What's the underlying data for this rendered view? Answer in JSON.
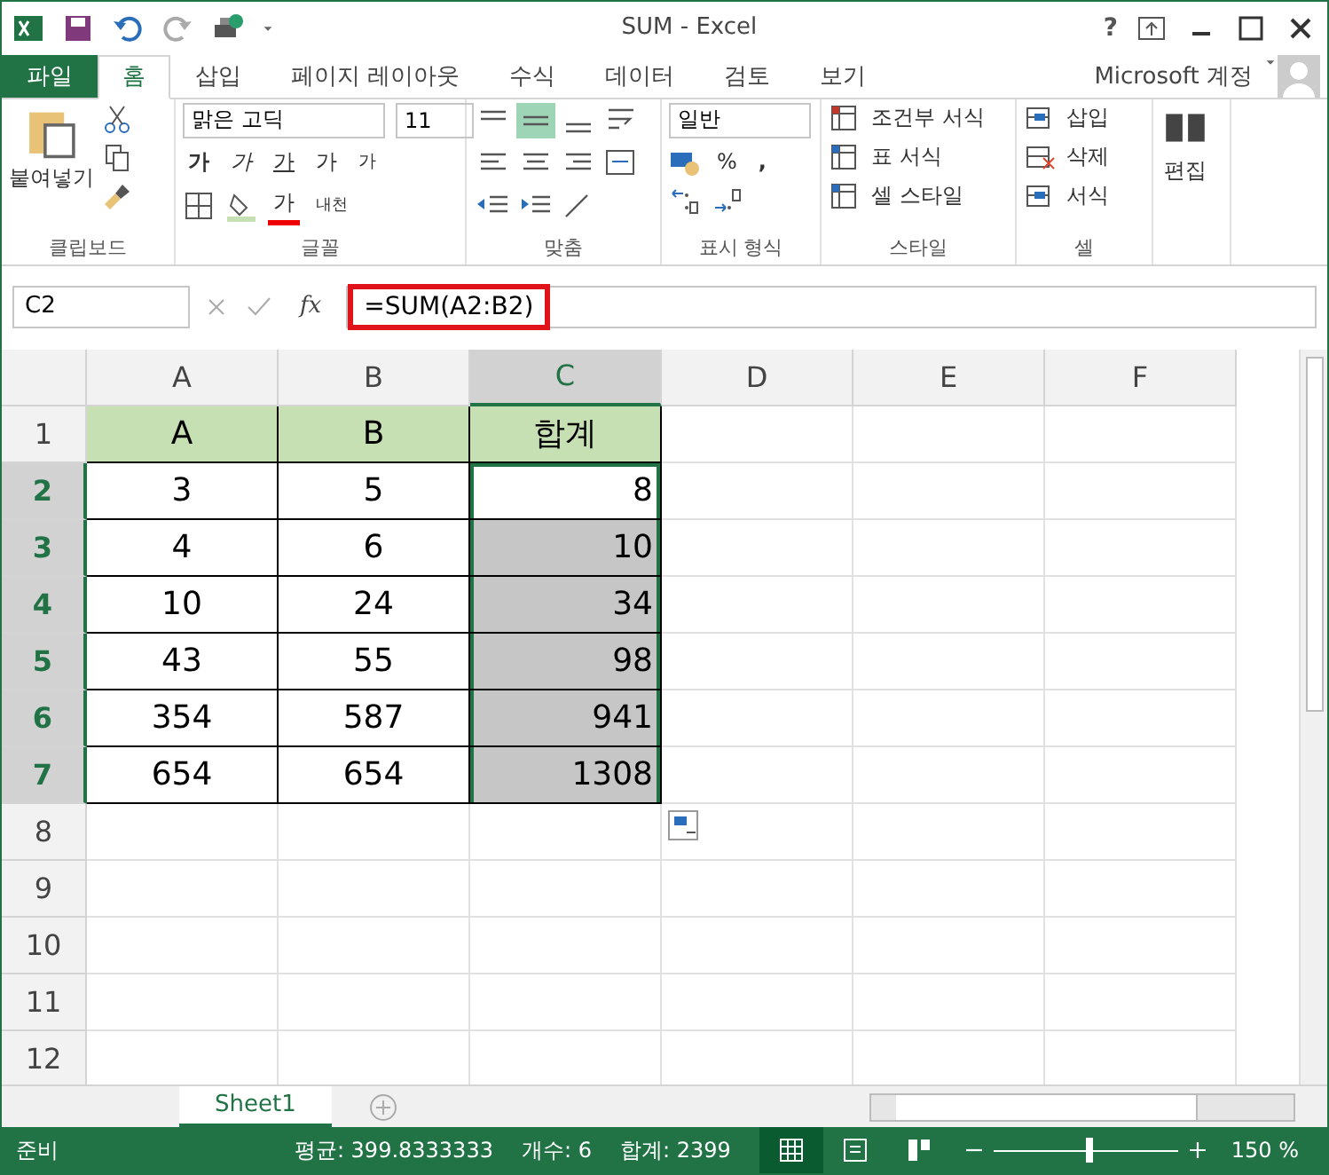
{
  "window": {
    "title": "SUM - Excel",
    "controls": [
      "?"
    ]
  },
  "tabs": [
    {
      "label": "파일",
      "kind": "file",
      "selected": false
    },
    {
      "label": "홈",
      "kind": "tab",
      "selected": true
    },
    {
      "label": "삽입",
      "kind": "tab",
      "selected": false
    },
    {
      "label": "페이지 레이아웃",
      "kind": "tab",
      "selected": false
    },
    {
      "label": "수식",
      "kind": "tab",
      "selected": false
    },
    {
      "label": "데이터",
      "kind": "tab",
      "selected": false
    },
    {
      "label": "검토",
      "kind": "tab",
      "selected": false
    },
    {
      "label": "보기",
      "kind": "tab",
      "selected": false
    }
  ],
  "account": {
    "label": "Microsoft 계정"
  },
  "ribbon": {
    "clipboard": {
      "label": "클립보드",
      "paste": "붙여넣기"
    },
    "font": {
      "label": "글꼴",
      "font_name": "맑은 고딕",
      "font_size": "11",
      "bold": "가",
      "italic": "가",
      "underline": "가",
      "grow": "가",
      "shrink": "가",
      "font_color": "가",
      "phonetic": "내천"
    },
    "alignment": {
      "label": "맞춤",
      "middle_align_selected": true
    },
    "number": {
      "label": "표시 형식",
      "format": "일반",
      "percent": "%",
      "comma": ","
    },
    "styles": {
      "label": "스타일",
      "items": [
        "조건부 서식",
        "표 서식",
        "셀 스타일"
      ]
    },
    "cells": {
      "label": "셀",
      "items": [
        "삽입",
        "삭제",
        "서식"
      ]
    },
    "editing": {
      "label": "편집"
    }
  },
  "formula_bar": {
    "name_box": "C2",
    "fx": "fx",
    "formula": "=SUM(A2:B2)",
    "highlighted": true
  },
  "columns": [
    {
      "label": "A",
      "selected": false
    },
    {
      "label": "B",
      "selected": false
    },
    {
      "label": "C",
      "selected": true
    },
    {
      "label": "D",
      "selected": false
    },
    {
      "label": "E",
      "selected": false
    },
    {
      "label": "F",
      "selected": false
    }
  ],
  "rows": [
    {
      "header": "1",
      "selected": false,
      "kind": "header",
      "cells": [
        {
          "text": "A",
          "selected": false,
          "active": false
        },
        {
          "text": "B",
          "selected": false,
          "active": false
        },
        {
          "text": "합계",
          "selected": false,
          "active": false
        }
      ]
    },
    {
      "header": "2",
      "selected": true,
      "kind": "data",
      "cells": [
        {
          "text": "3",
          "selected": false,
          "active": false
        },
        {
          "text": "5",
          "selected": false,
          "active": false
        },
        {
          "text": "8",
          "selected": true,
          "active": true
        }
      ]
    },
    {
      "header": "3",
      "selected": true,
      "kind": "data",
      "cells": [
        {
          "text": "4",
          "selected": false,
          "active": false
        },
        {
          "text": "6",
          "selected": false,
          "active": false
        },
        {
          "text": "10",
          "selected": true,
          "active": false
        }
      ]
    },
    {
      "header": "4",
      "selected": true,
      "kind": "data",
      "cells": [
        {
          "text": "10",
          "selected": false,
          "active": false
        },
        {
          "text": "24",
          "selected": false,
          "active": false
        },
        {
          "text": "34",
          "selected": true,
          "active": false
        }
      ]
    },
    {
      "header": "5",
      "selected": true,
      "kind": "data",
      "cells": [
        {
          "text": "43",
          "selected": false,
          "active": false
        },
        {
          "text": "55",
          "selected": false,
          "active": false
        },
        {
          "text": "98",
          "selected": true,
          "active": false
        }
      ]
    },
    {
      "header": "6",
      "selected": true,
      "kind": "data",
      "cells": [
        {
          "text": "354",
          "selected": false,
          "active": false
        },
        {
          "text": "587",
          "selected": false,
          "active": false
        },
        {
          "text": "941",
          "selected": true,
          "active": false
        }
      ]
    },
    {
      "header": "7",
      "selected": true,
      "kind": "data",
      "cells": [
        {
          "text": "654",
          "selected": false,
          "active": false
        },
        {
          "text": "654",
          "selected": false,
          "active": false
        },
        {
          "text": "1308",
          "selected": true,
          "active": false
        }
      ]
    },
    {
      "header": "8",
      "selected": false,
      "kind": "empty",
      "cells": []
    },
    {
      "header": "9",
      "selected": false,
      "kind": "empty",
      "cells": []
    },
    {
      "header": "10",
      "selected": false,
      "kind": "empty",
      "cells": []
    },
    {
      "header": "11",
      "selected": false,
      "kind": "empty",
      "cells": []
    },
    {
      "header": "12",
      "selected": false,
      "kind": "empty",
      "cells": []
    }
  ],
  "sheets": [
    {
      "label": "Sheet1",
      "selected": true
    }
  ],
  "status_bar": {
    "status": "준비",
    "stats": [
      "평균: 399.8333333",
      "개수: 6",
      "합계: 2399"
    ],
    "views": [
      {
        "kind": "normal",
        "selected": true
      },
      {
        "kind": "layout",
        "selected": false
      },
      {
        "kind": "break",
        "selected": false
      }
    ],
    "zoom": {
      "level": 0.52,
      "reading": "150 %"
    }
  }
}
